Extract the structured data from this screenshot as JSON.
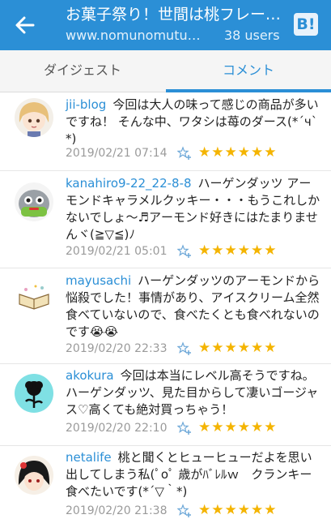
{
  "header": {
    "title": "お菓子祭り！世間は桃フレーバーとかで…",
    "url": "www.nomunomutuku...",
    "user_count": "38",
    "users_label": "users",
    "hatena_button": "B!"
  },
  "tabs": [
    {
      "label": "ダイジェスト",
      "active": false
    },
    {
      "label": "コメント",
      "active": true
    }
  ],
  "comments": [
    {
      "user": "jii-blog",
      "text": "今回は大人の味って感じの商品が多いですね！ そんな中、ワタシは苺のダース(*´ч`*)",
      "date": "2019/02/21 07:14",
      "stars": "★★★★★★"
    },
    {
      "user": "kanahiro9-22_22-8-8",
      "text": "ハーゲンダッツ アーモンドキャラメルクッキー・・・もうこれしかないでしょ～♬アーモンド好きにはたまりませんヾ(≧▽≦)ﾉ",
      "date": "2019/02/21 05:01",
      "stars": "★★★★★★"
    },
    {
      "user": "mayusachi",
      "text": "ハーゲンダッツのアーモンドから悩殺でした！事情があり、アイスクリーム全然食べていないので、食べたくとも食べれないのです😭😭",
      "date": "2019/02/20 22:33",
      "stars": "★★★★★★"
    },
    {
      "user": "akokura",
      "text": "今回は本当にレベル高そうですね。ハーゲンダッツ、見た目からして凄いゴージャス♡高くても絶対買っちゃう！",
      "date": "2019/02/20 22:10",
      "stars": "★★★★★★"
    },
    {
      "user": "netalife",
      "text": "桃と聞くとヒューヒューだよを思い出してしまう私(ﾟoﾟ 歳がﾊﾞﾚﾙｗ　クランキー食べたいです(*´▽｀*)",
      "date": "2019/02/20 21:38",
      "stars": "★★★★★★"
    }
  ],
  "colors": {
    "accent": "#2b8fd6",
    "star": "#f4b400"
  }
}
